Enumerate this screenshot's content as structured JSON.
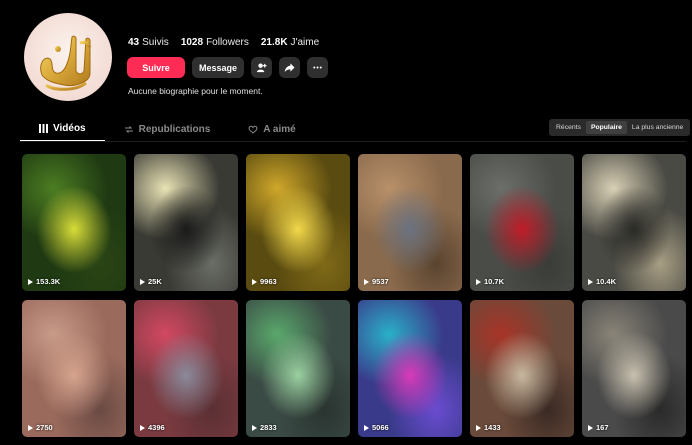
{
  "profile": {
    "stats": [
      {
        "value": "43",
        "label": "Suivis"
      },
      {
        "value": "1028",
        "label": "Followers"
      },
      {
        "value": "21.8K",
        "label": "J'aime"
      }
    ],
    "follow_label": "Suivre",
    "message_label": "Message",
    "bio": "Aucune biographie pour le moment."
  },
  "tabs": [
    {
      "label": "Vidéos",
      "icon": "grid-icon"
    },
    {
      "label": "Republications",
      "icon": "repost-icon"
    },
    {
      "label": "A aimé",
      "icon": "heart-icon"
    }
  ],
  "sort": [
    "Récents",
    "Populaire",
    "La plus ancienne"
  ],
  "videos": [
    {
      "views": "153.3K",
      "colors": [
        "#1f3a12",
        "#4c7d22",
        "#d8dc38",
        "#2a4414"
      ]
    },
    {
      "views": "25K",
      "colors": [
        "#3a3a34",
        "#e8e2b4",
        "#1a1a1a",
        "#6a6e66"
      ]
    },
    {
      "views": "9963",
      "colors": [
        "#5a4b10",
        "#cfa72a",
        "#f2d84a",
        "#806a18"
      ]
    },
    {
      "views": "9537",
      "colors": [
        "#8a6a4c",
        "#b8906a",
        "#6a7280",
        "#5a4430"
      ]
    },
    {
      "views": "10.7K",
      "colors": [
        "#4a4c48",
        "#6c6e6a",
        "#c01c28",
        "#3a3c38"
      ]
    },
    {
      "views": "10.4K",
      "colors": [
        "#4a4a44",
        "#d8cfb4",
        "#2a2a26",
        "#a89e84"
      ]
    },
    {
      "views": "2750",
      "colors": [
        "#9a6a5c",
        "#c89a88",
        "#d6a48e",
        "#6a4a44"
      ]
    },
    {
      "views": "4396",
      "colors": [
        "#7a3a40",
        "#d24862",
        "#8a8a9a",
        "#5a3034"
      ]
    },
    {
      "views": "2833",
      "colors": [
        "#3a4a44",
        "#5aa86c",
        "#9ad0a0",
        "#2a3430"
      ]
    },
    {
      "views": "5066",
      "colors": [
        "#3a3a8a",
        "#2ab0c8",
        "#d83ab8",
        "#6a4cd0"
      ]
    },
    {
      "views": "1433",
      "colors": [
        "#6a4a3a",
        "#a83428",
        "#c8b8a0",
        "#3a2a24"
      ]
    },
    {
      "views": "167",
      "colors": [
        "#4a4a4a",
        "#8a8478",
        "#c8c0ae",
        "#2a2a2a"
      ]
    }
  ]
}
